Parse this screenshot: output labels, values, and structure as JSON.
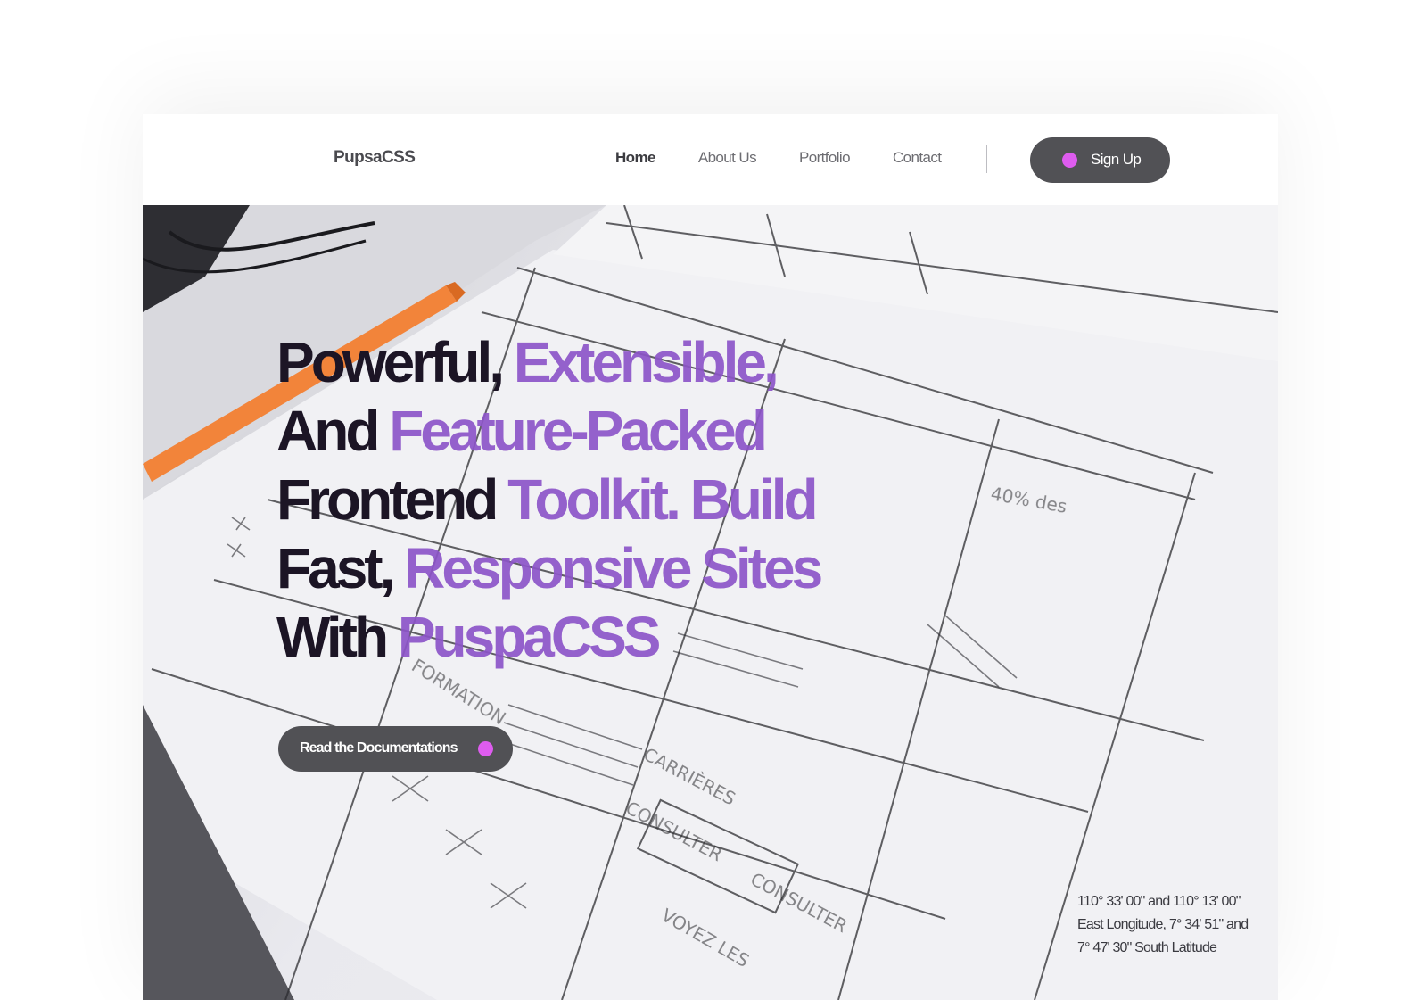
{
  "brand": "PupsaCSS",
  "nav": {
    "items": [
      {
        "label": "Home",
        "active": true
      },
      {
        "label": "About Us",
        "active": false
      },
      {
        "label": "Portfolio",
        "active": false
      },
      {
        "label": "Contact",
        "active": false
      }
    ],
    "signup_label": "Sign Up"
  },
  "hero": {
    "headline": [
      [
        {
          "text": "Powerful, ",
          "accent": false
        },
        {
          "text": "Extensible,",
          "accent": true
        }
      ],
      [
        {
          "text": "And ",
          "accent": false
        },
        {
          "text": "Feature-Packed",
          "accent": true
        }
      ],
      [
        {
          "text": "Frontend ",
          "accent": false
        },
        {
          "text": "Toolkit. Build",
          "accent": true
        }
      ],
      [
        {
          "text": "Fast, ",
          "accent": false
        },
        {
          "text": "Responsive Sites",
          "accent": true
        }
      ],
      [
        {
          "text": "With ",
          "accent": false
        },
        {
          "text": "PuspaCSS",
          "accent": true
        }
      ]
    ],
    "cta_label": "Read the Documentations",
    "coordinates": [
      "110° 33' 00\" and 110° 13' 00\"",
      "East Longitude, 7° 34' 51\" and",
      "7° 47' 30\" South Latitude"
    ]
  },
  "colors": {
    "accent_dot": "#de5cef",
    "button_bg": "#515155",
    "headline_dark": "#1c1525",
    "headline_accent": "#8d55c8"
  },
  "icons": [
    "dot-icon"
  ]
}
